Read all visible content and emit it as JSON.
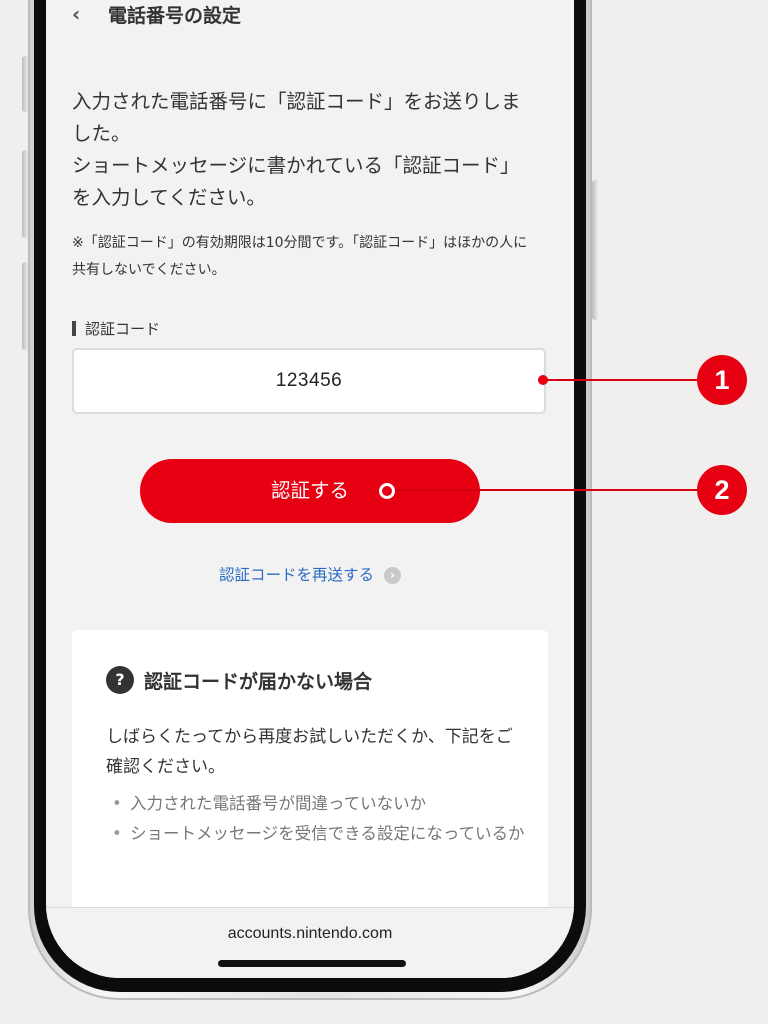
{
  "nav": {
    "back_icon": "chevron-left-icon",
    "back_glyph": "‹",
    "title": "電話番号の設定"
  },
  "intro": {
    "line1": "入力された電話番号に「認証コード」をお送りしました。",
    "line2": "ショートメッセージに書かれている「認証コード」を入力してください。"
  },
  "note": "※「認証コード」の有効期限は10分間です。「認証コード」はほかの人に共有しないでください。",
  "field": {
    "label": "認証コード",
    "value": "123456"
  },
  "verify_button": {
    "label": "認証する"
  },
  "resend_link": {
    "label": "認証コードを再送する",
    "icon": "chevron-right-circle-icon",
    "glyph": "›"
  },
  "help": {
    "icon": "question-circle-icon",
    "icon_glyph": "?",
    "title": "認証コードが届かない場合",
    "body": "しばらくたってから再度お試しいただくか、下記をご確認ください。",
    "items": [
      "入力された電話番号が間違っていないか",
      "ショートメッセージを受信できる設定になっているか"
    ]
  },
  "browser": {
    "url": "accounts.nintendo.com"
  },
  "callouts": [
    {
      "number": "1"
    },
    {
      "number": "2"
    }
  ],
  "colors": {
    "accent": "#e60012",
    "link": "#2b6cc4",
    "screen_bg": "#f2f2f2"
  }
}
